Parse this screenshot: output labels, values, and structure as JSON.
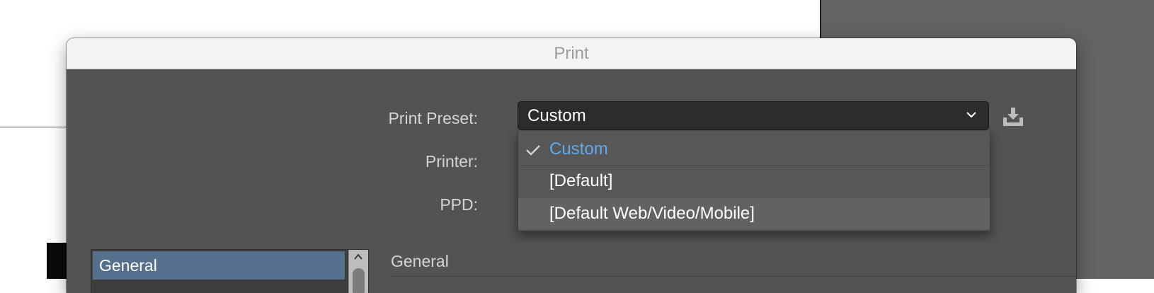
{
  "dialog": {
    "title": "Print"
  },
  "form": {
    "print_preset_label": "Print Preset:",
    "printer_label": "Printer:",
    "ppd_label": "PPD:",
    "print_preset_value": "Custom"
  },
  "preset_menu": {
    "items": [
      {
        "label": "Custom",
        "selected": true
      },
      {
        "label": "[Default]",
        "selected": false
      },
      {
        "label": "[Default Web/Video/Mobile]",
        "selected": false,
        "highlighted": true
      }
    ]
  },
  "sidebar": {
    "items": [
      {
        "label": "General",
        "selected": true
      }
    ]
  },
  "main": {
    "section_title": "General"
  },
  "icons": {
    "preset_dropdown": "chevron-down-icon",
    "save_preset": "save-preset-icon",
    "checkmark": "checkmark-icon",
    "scroll_up": "scroll-up-arrow-icon"
  },
  "colors": {
    "dialog_bg": "#535353",
    "selected_menu_text": "#5ea9f0",
    "sidebar_selected": "#54708d"
  }
}
